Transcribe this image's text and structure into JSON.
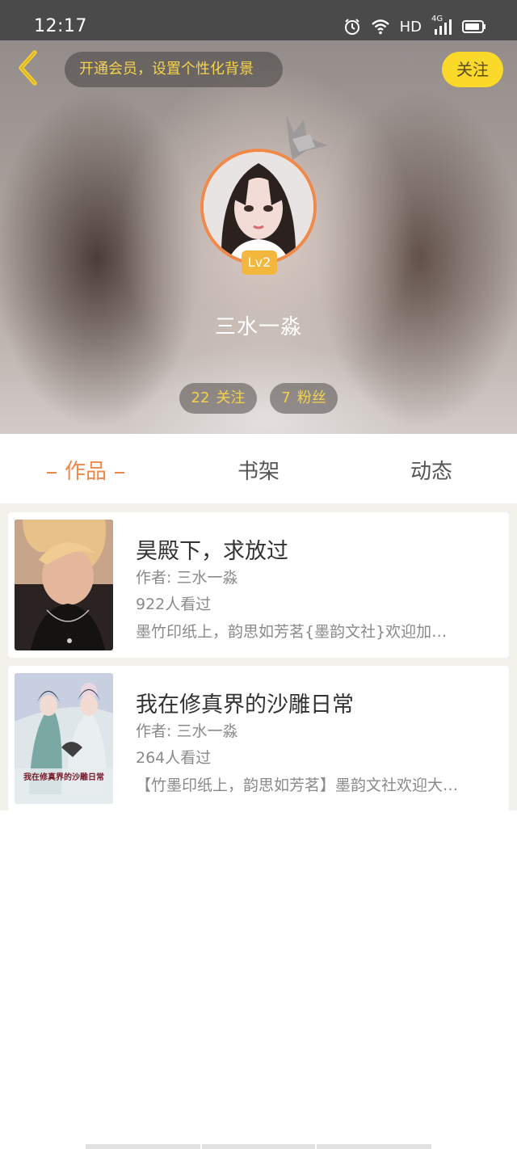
{
  "status_bar": {
    "time": "12:17",
    "hd_label": "HD",
    "network_label": "4G",
    "icons": [
      "alarm-icon",
      "wifi-icon",
      "signal-icon",
      "battery-icon"
    ]
  },
  "header": {
    "vip_banner": "开通会员，设置个性化背景",
    "follow_button": "关注",
    "level_badge": "Lv2",
    "username": "三水一淼",
    "following_count": "22",
    "following_label": "关注",
    "fans_count": "7",
    "fans_label": "粉丝"
  },
  "tabs": [
    {
      "label": "作品",
      "active": true
    },
    {
      "label": "书架",
      "active": false
    },
    {
      "label": "动态",
      "active": false
    }
  ],
  "books": [
    {
      "title": "昊殿下，求放过",
      "author": "作者: 三水一淼",
      "views": "922人看过",
      "description": "墨竹印纸上，韵思如芳茗{墨韵文社}欢迎加…"
    },
    {
      "title": "我在修真界的沙雕日常",
      "author": "作者: 三水一淼",
      "views": "264人看过",
      "description": "【竹墨印纸上，韵思如芳茗】墨韵文社欢迎大…",
      "cover_text": "我在修真界的沙雕日常"
    }
  ],
  "colors": {
    "accent_orange": "#ee8848",
    "accent_yellow": "#f6d34c",
    "follow_button_bg": "#fbd92a",
    "level_badge_bg": "#f4b73e"
  }
}
